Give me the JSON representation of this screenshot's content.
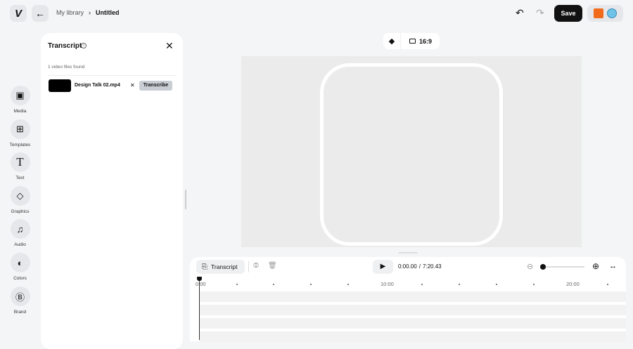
{
  "header": {
    "logo": "V",
    "back_icon": "arrow-left-icon",
    "breadcrumb": {
      "parent": "My library",
      "current": "Untitled"
    },
    "save_label": "Save"
  },
  "sidebar": {
    "items": [
      {
        "label": "Media",
        "icon": "image-icon",
        "glyph": "▣"
      },
      {
        "label": "Templates",
        "icon": "template-icon",
        "glyph": "⊞"
      },
      {
        "label": "Text",
        "icon": "text-icon",
        "glyph": "T"
      },
      {
        "label": "Graphics",
        "icon": "shapes-icon",
        "glyph": "◇"
      },
      {
        "label": "Audio",
        "icon": "music-icon",
        "glyph": "♫"
      },
      {
        "label": "Colors",
        "icon": "palette-icon",
        "glyph": "◐"
      },
      {
        "label": "Brand",
        "icon": "brand-icon",
        "glyph": "Ⓑ"
      }
    ]
  },
  "transcript_panel": {
    "title": "Transcript",
    "count_text": "1 video files found",
    "file": {
      "name": "Design Talk 02.mp4",
      "action": "Transcribe"
    }
  },
  "canvas": {
    "aspect_ratio": "16:9"
  },
  "timeline": {
    "transcript_label": "Transcript",
    "current_time": "0:00.00",
    "separator": "/",
    "duration": "7:20.43",
    "ruler": [
      "0:00",
      "10:00",
      "20:00"
    ],
    "zoom_level": 0
  }
}
